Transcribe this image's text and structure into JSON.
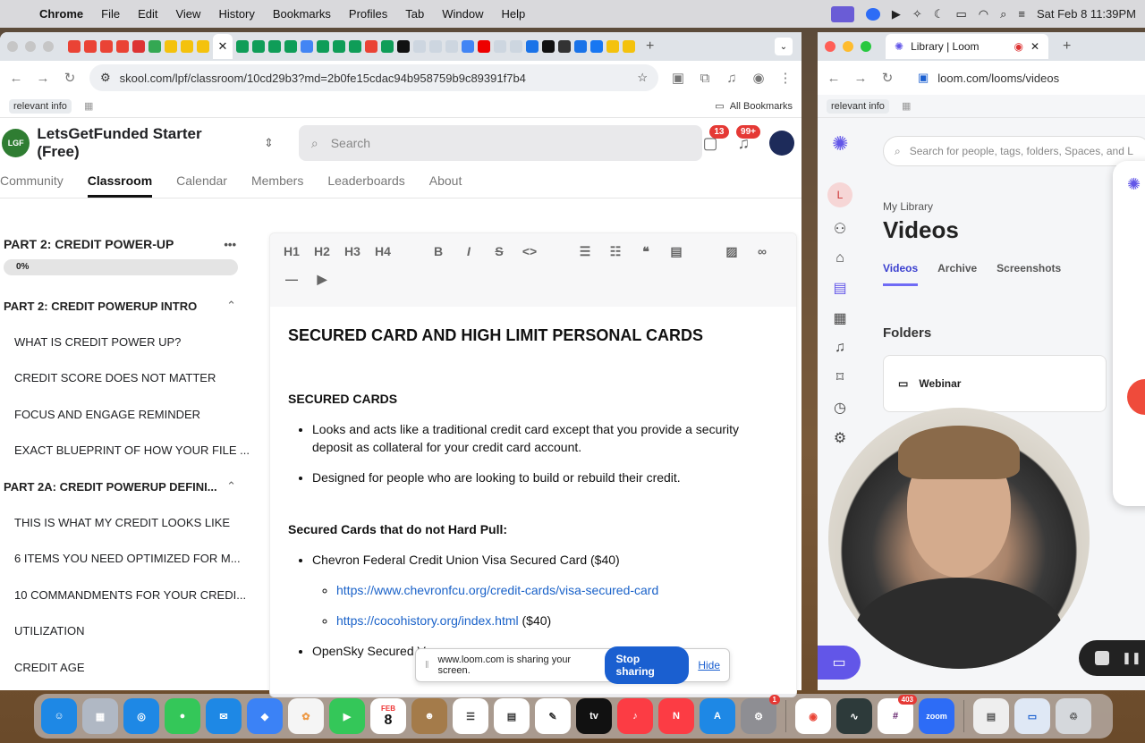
{
  "menubar": {
    "app": "Chrome",
    "items": [
      "File",
      "Edit",
      "View",
      "History",
      "Bookmarks",
      "Profiles",
      "Tab",
      "Window",
      "Help"
    ],
    "datetime": "Sat Feb 8  11:39PM"
  },
  "left_browser": {
    "url": "skool.com/lpf/classroom/10cd29b3?md=2b0fe15cdac94b958759b9c89391f7b4",
    "bookmark_chip": "relevant info",
    "all_bookmarks": "All Bookmarks"
  },
  "skool": {
    "group_name": "LetsGetFunded Starter (Free)",
    "search_placeholder": "Search",
    "chat_badge": "13",
    "notif_badge": "99+",
    "tabs": [
      "Community",
      "Classroom",
      "Calendar",
      "Members",
      "Leaderboards",
      "About"
    ],
    "active_tab": "Classroom"
  },
  "course": {
    "title": "PART 2: CREDIT POWER-UP",
    "progress": "0%",
    "section1": "PART 2: CREDIT POWERUP INTRO",
    "lessons1": [
      "WHAT IS CREDIT POWER UP?",
      "CREDIT SCORE DOES NOT MATTER",
      "FOCUS AND ENGAGE REMINDER",
      "EXACT BLUEPRINT OF HOW YOUR FILE ..."
    ],
    "section2": "PART 2A: CREDIT POWERUP DEFINI...",
    "lessons2": [
      "THIS IS WHAT MY CREDIT LOOKS LIKE",
      "6 ITEMS YOU NEED OPTIMIZED FOR M...",
      "10 COMMANDMENTS FOR YOUR CREDI...",
      "UTILIZATION",
      "CREDIT AGE"
    ]
  },
  "editor": {
    "toolbar": [
      "H1",
      "H2",
      "H3",
      "H4",
      "B",
      "I",
      "S",
      "<>"
    ],
    "doc_title": "SECURED CARD AND HIGH LIMIT PERSONAL CARDS",
    "h_secured": "SECURED CARDS",
    "bullet1": "Looks and acts like a traditional credit card except that you provide a security deposit as collateral for your credit card account.",
    "bullet2": "Designed for people who are looking to build or rebuild their credit.",
    "h_nohard": "Secured Cards that do not Hard Pull:",
    "card1": "Chevron Federal Credit Union Visa Secured Card ($40)",
    "link1": "https://www.chevronfcu.org/credit-cards/visa-secured-card",
    "link2": "https://cocohistory.org/index.html",
    "link2_suffix": "($40)",
    "card2": "OpenSky Secured V"
  },
  "sharebar": {
    "text": "www.loom.com is sharing your screen.",
    "stop": "Stop sharing",
    "hide": "Hide"
  },
  "right_browser": {
    "tab_title": "Library | Loom",
    "url": "loom.com/looms/videos",
    "bookmark_chip": "relevant info"
  },
  "loom": {
    "avatar_letter": "L",
    "search_placeholder": "Search for people, tags, folders, Spaces, and L",
    "library_label": "My Library",
    "title": "Videos",
    "tabs": [
      "Videos",
      "Archive",
      "Screenshots"
    ],
    "folders_heading": "Folders",
    "folder_name": "Webinar"
  },
  "dock": {
    "calendar_month": "FEB",
    "calendar_day": "8",
    "settings_badge": "1",
    "slack_badge": "403",
    "zoom_label": "zoom"
  }
}
